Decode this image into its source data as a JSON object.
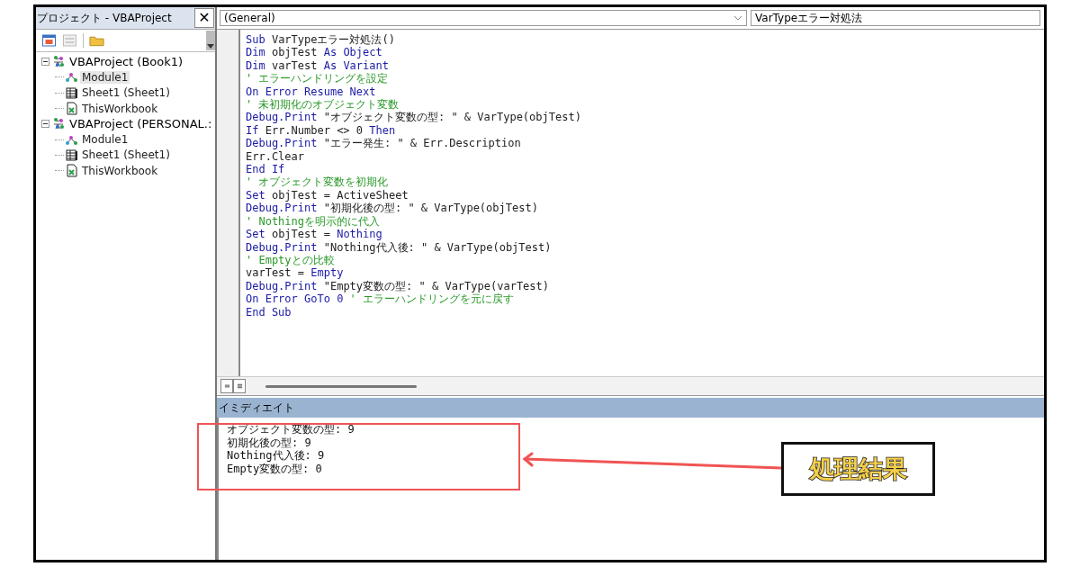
{
  "project_panel": {
    "title": "プロジェクト - VBAProject",
    "close": "✕",
    "tree": [
      {
        "label": "VBAProject (Book1)",
        "kind": "project",
        "selected": false,
        "expanded": true,
        "children": [
          {
            "label": "Module1",
            "kind": "module",
            "selected": true
          },
          {
            "label": "Sheet1 (Sheet1)",
            "kind": "sheet",
            "selected": false
          },
          {
            "label": "ThisWorkbook",
            "kind": "workbook",
            "selected": false
          }
        ]
      },
      {
        "label": "VBAProject (PERSONAL.:",
        "kind": "project",
        "selected": false,
        "expanded": true,
        "children": [
          {
            "label": "Module1",
            "kind": "module",
            "selected": false
          },
          {
            "label": "Sheet1 (Sheet1)",
            "kind": "sheet",
            "selected": false
          },
          {
            "label": "ThisWorkbook",
            "kind": "workbook",
            "selected": false
          }
        ]
      }
    ]
  },
  "code_window": {
    "object_combo": "(General)",
    "procedure_combo": "VarTypeエラー対処法",
    "lines": [
      [
        {
          "kind": "keyword",
          "text": "Sub"
        },
        {
          "kind": "plain",
          "text": " VarTypeエラー対処法()"
        }
      ],
      [
        {
          "kind": "keyword",
          "text": "Dim"
        },
        {
          "kind": "plain",
          "text": " objTest "
        },
        {
          "kind": "keyword",
          "text": "As Object"
        }
      ],
      [
        {
          "kind": "keyword",
          "text": "Dim"
        },
        {
          "kind": "plain",
          "text": " varTest "
        },
        {
          "kind": "keyword",
          "text": "As Variant"
        }
      ],
      [
        {
          "kind": "comment",
          "text": "' エラーハンドリングを設定"
        }
      ],
      [
        {
          "kind": "keyword",
          "text": "On Error Resume Next"
        }
      ],
      [
        {
          "kind": "comment",
          "text": "' 未初期化のオブジェクト変数"
        }
      ],
      [
        {
          "kind": "keyword",
          "text": "Debug.Print"
        },
        {
          "kind": "plain",
          "text": " \"オブジェクト変数の型: \" & VarType(objTest)"
        }
      ],
      [
        {
          "kind": "keyword",
          "text": "If"
        },
        {
          "kind": "plain",
          "text": " Err.Number <> 0 "
        },
        {
          "kind": "keyword",
          "text": "Then"
        }
      ],
      [
        {
          "kind": "keyword",
          "text": "Debug.Print"
        },
        {
          "kind": "plain",
          "text": " \"エラー発生: \" & Err.Description"
        }
      ],
      [
        {
          "kind": "plain",
          "text": "Err.Clear"
        }
      ],
      [
        {
          "kind": "keyword",
          "text": "End If"
        }
      ],
      [
        {
          "kind": "comment",
          "text": "' オブジェクト変数を初期化"
        }
      ],
      [
        {
          "kind": "keyword",
          "text": "Set"
        },
        {
          "kind": "plain",
          "text": " objTest = ActiveSheet"
        }
      ],
      [
        {
          "kind": "keyword",
          "text": "Debug.Print"
        },
        {
          "kind": "plain",
          "text": " \"初期化後の型: \" & VarType(objTest)"
        }
      ],
      [
        {
          "kind": "comment",
          "text": "' Nothingを明示的に代入"
        }
      ],
      [
        {
          "kind": "keyword",
          "text": "Set"
        },
        {
          "kind": "plain",
          "text": " objTest = "
        },
        {
          "kind": "keyword",
          "text": "Nothing"
        }
      ],
      [
        {
          "kind": "keyword",
          "text": "Debug.Print"
        },
        {
          "kind": "plain",
          "text": " \"Nothing代入後: \" & VarType(objTest)"
        }
      ],
      [
        {
          "kind": "comment",
          "text": "' Emptyとの比較"
        }
      ],
      [
        {
          "kind": "plain",
          "text": "varTest = "
        },
        {
          "kind": "keyword",
          "text": "Empty"
        }
      ],
      [
        {
          "kind": "keyword",
          "text": "Debug.Print"
        },
        {
          "kind": "plain",
          "text": " \"Empty変数の型: \" & VarType(varTest)"
        }
      ],
      [
        {
          "kind": "keyword",
          "text": "On Error GoTo 0 "
        },
        {
          "kind": "comment",
          "text": "' エラーハンドリングを元に戻す"
        }
      ],
      [
        {
          "kind": "keyword",
          "text": "End Sub"
        }
      ]
    ]
  },
  "immediate_window": {
    "title": "イミディエイト",
    "lines": [
      "オブジェクト変数の型: 9",
      "初期化後の型: 9",
      "Nothing代入後: 9",
      "Empty変数の型: 0"
    ]
  },
  "callout": {
    "label": "処理結果"
  }
}
